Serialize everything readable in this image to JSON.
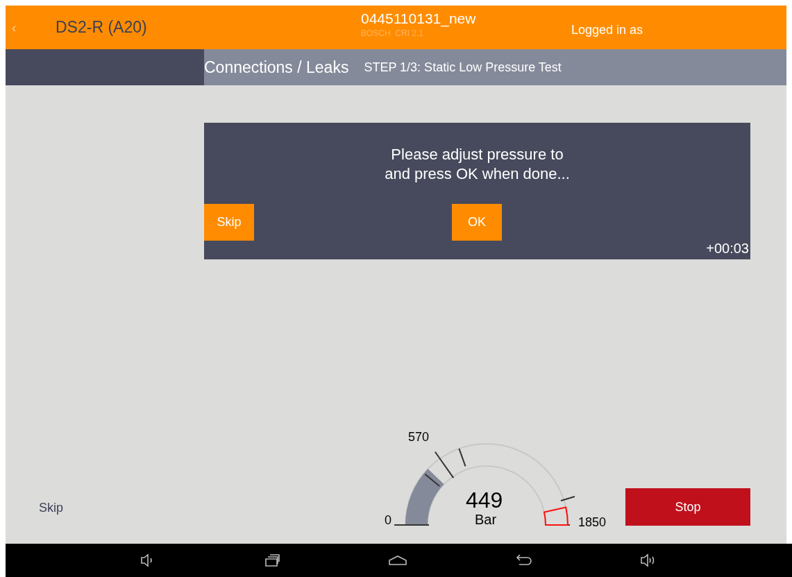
{
  "header": {
    "back": "‹",
    "device": "DS2-R (A20)",
    "injector": "0445110131_new",
    "subtitle": "BOSCH  CRI 2.1",
    "login": "Logged in as"
  },
  "breadcrumb": {
    "section": "Connections / Leaks",
    "step": "STEP 1/3: Static Low Pressure Test"
  },
  "dialog": {
    "message_lines": [
      "Please adjust pressure to",
      "and press OK when done..."
    ],
    "buttons": [
      "Skip",
      "OK"
    ],
    "timer": "+00:03"
  },
  "gauge": {
    "level": 0.243,
    "reading": "449",
    "unit": "Bar",
    "min_label": "0",
    "max_label": "1850",
    "tick_label": "570"
  },
  "footer": {
    "skip": "Skip",
    "stop": "Stop"
  }
}
